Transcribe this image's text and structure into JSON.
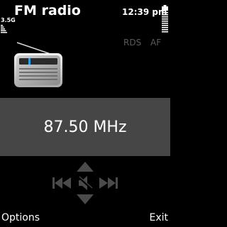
{
  "header": {
    "title": "FM radio",
    "clock": "12:39 pm",
    "network_label": "3.5G",
    "battery_icon": "battery-icon",
    "signal_icon": "signal-bars-icon"
  },
  "radio": {
    "icon": "radio-icon",
    "rds_label": "RDS",
    "af_label": "AF",
    "frequency": "87.50 MHz"
  },
  "navigation": {
    "up_icon": "arrow-up-icon",
    "down_icon": "arrow-down-icon",
    "seek_back_icon": "seek-back-icon",
    "seek_forward_icon": "seek-forward-icon",
    "speaker_icon": "speaker-mute-icon"
  },
  "softkeys": {
    "left": "Options",
    "right": "Exit"
  },
  "colors": {
    "background": "#000000",
    "band": "#464646",
    "disabled_text": "#5a5a5a",
    "nav_grey": "#4a4a4a"
  }
}
